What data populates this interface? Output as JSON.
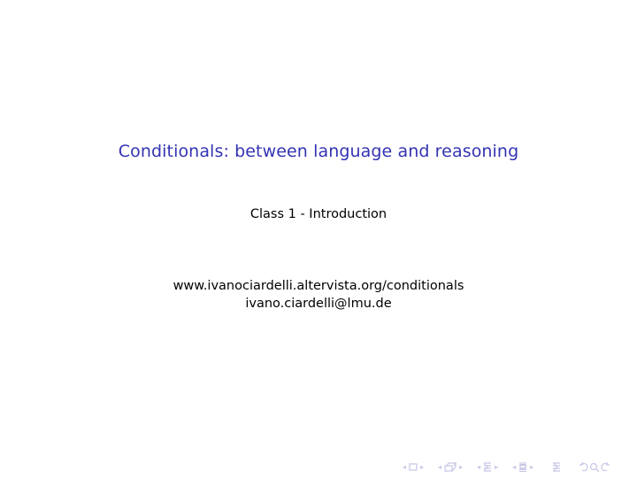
{
  "slide": {
    "title": "Conditionals: between language and reasoning",
    "subtitle": "Class 1 - Introduction",
    "url": "www.ivanociardelli.altervista.org/conditionals",
    "email": "ivano.ciardelli@lmu.de"
  },
  "navigation": {
    "arrow_left": "◂",
    "arrow_right": "▸",
    "icons": [
      "frame-icon",
      "subsection-icon",
      "section-icon",
      "subsubsection-icon",
      "toc-icon",
      "search-undo-redo-icon"
    ],
    "color": "#c6c6e6"
  }
}
